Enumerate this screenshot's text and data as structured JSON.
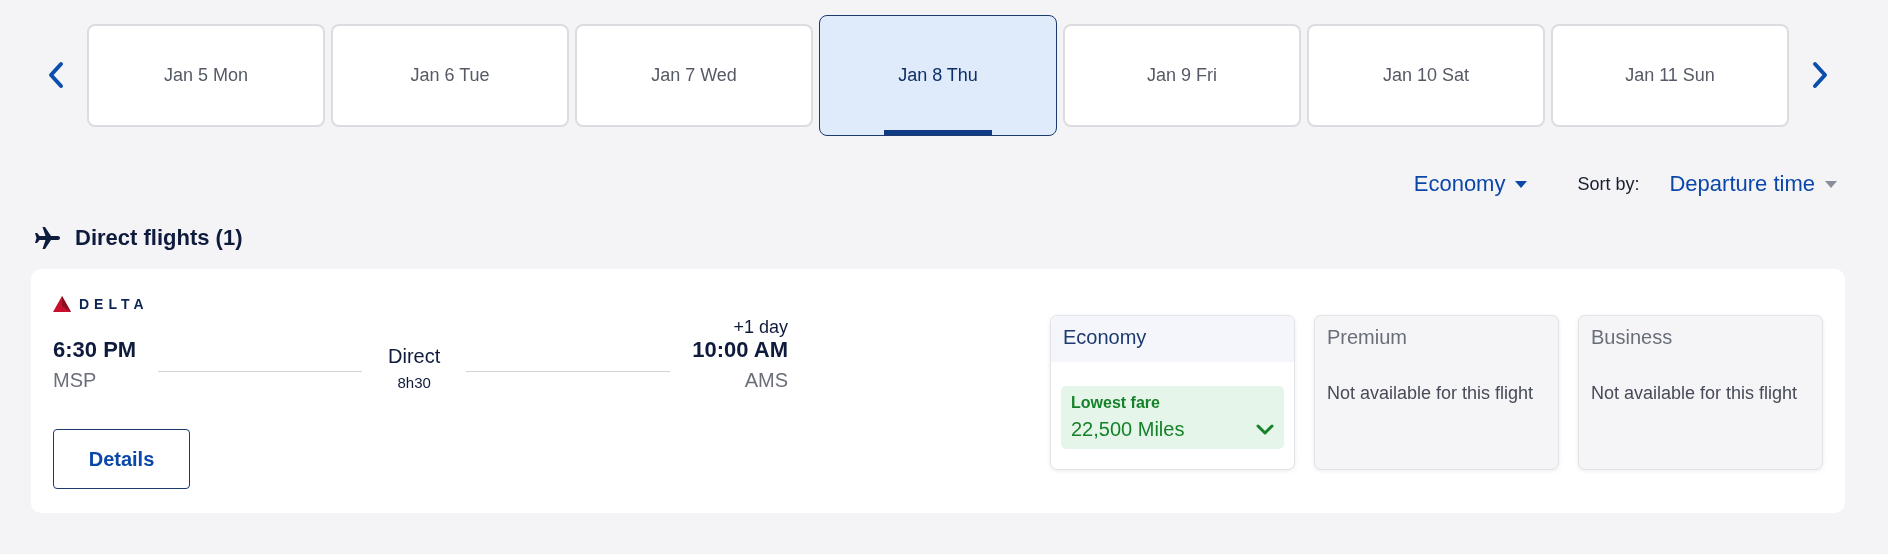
{
  "date_tabs": [
    {
      "label": "Jan 5 Mon",
      "selected": false
    },
    {
      "label": "Jan 6 Tue",
      "selected": false
    },
    {
      "label": "Jan 7 Wed",
      "selected": false
    },
    {
      "label": "Jan 8 Thu",
      "selected": true
    },
    {
      "label": "Jan 9 Fri",
      "selected": false
    },
    {
      "label": "Jan 10 Sat",
      "selected": false
    },
    {
      "label": "Jan 11 Sun",
      "selected": false
    }
  ],
  "cabin_filter": {
    "value": "Economy"
  },
  "sort": {
    "label": "Sort by:",
    "value": "Departure time"
  },
  "section": {
    "title": "Direct flights (1)"
  },
  "flight": {
    "airline": "DELTA",
    "departure": {
      "time": "6:30 PM",
      "airport": "MSP"
    },
    "stops": "Direct",
    "duration": "8h30",
    "arrival": {
      "day_offset": "+1 day",
      "time": "10:00 AM",
      "airport": "AMS"
    },
    "details_button": "Details",
    "fares": [
      {
        "cabin": "Economy",
        "selected": true,
        "kind": "fare",
        "badge": "Lowest fare",
        "price": "22,500 Miles"
      },
      {
        "cabin": "Premium",
        "selected": false,
        "kind": "unavailable",
        "note": "Not available for this flight"
      },
      {
        "cabin": "Business",
        "selected": false,
        "kind": "unavailable",
        "note": "Not available for this flight"
      }
    ]
  }
}
